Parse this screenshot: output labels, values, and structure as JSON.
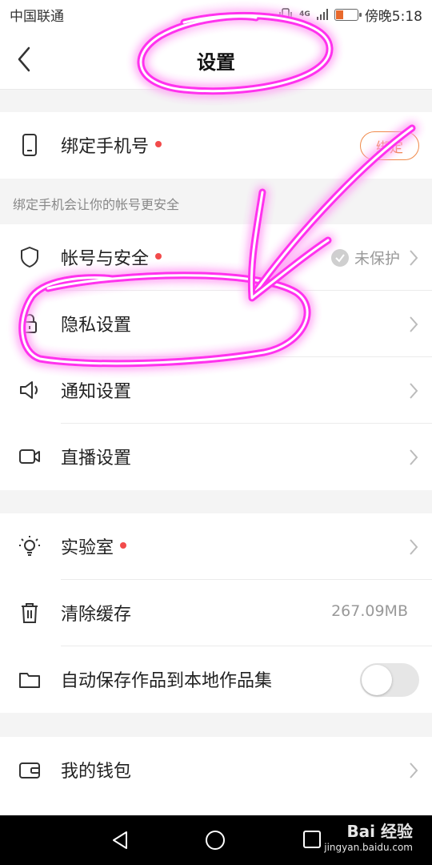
{
  "status_bar": {
    "carrier": "中国联通",
    "network": "4G",
    "time": "傍晚5:18"
  },
  "header": {
    "title": "设置"
  },
  "phone_binding": {
    "label": "绑定手机号",
    "button": "绑定",
    "hint": "绑定手机会让你的帐号更安全"
  },
  "settings": {
    "account_security": {
      "label": "帐号与安全",
      "status": "未保护"
    },
    "privacy": {
      "label": "隐私设置"
    },
    "notification": {
      "label": "通知设置"
    },
    "live": {
      "label": "直播设置"
    },
    "lab": {
      "label": "实验室"
    },
    "clear_cache": {
      "label": "清除缓存",
      "value": "267.09MB"
    },
    "auto_save": {
      "label": "自动保存作品到本地作品集",
      "enabled": false
    },
    "wallet": {
      "label": "我的钱包"
    }
  },
  "watermark": {
    "brand": "Bai 经验",
    "url": "jingyan.baidu.com"
  },
  "colors": {
    "accent": "#f08a4b",
    "red_dot": "#f24b4b",
    "annotation": "#ff3cf0"
  }
}
